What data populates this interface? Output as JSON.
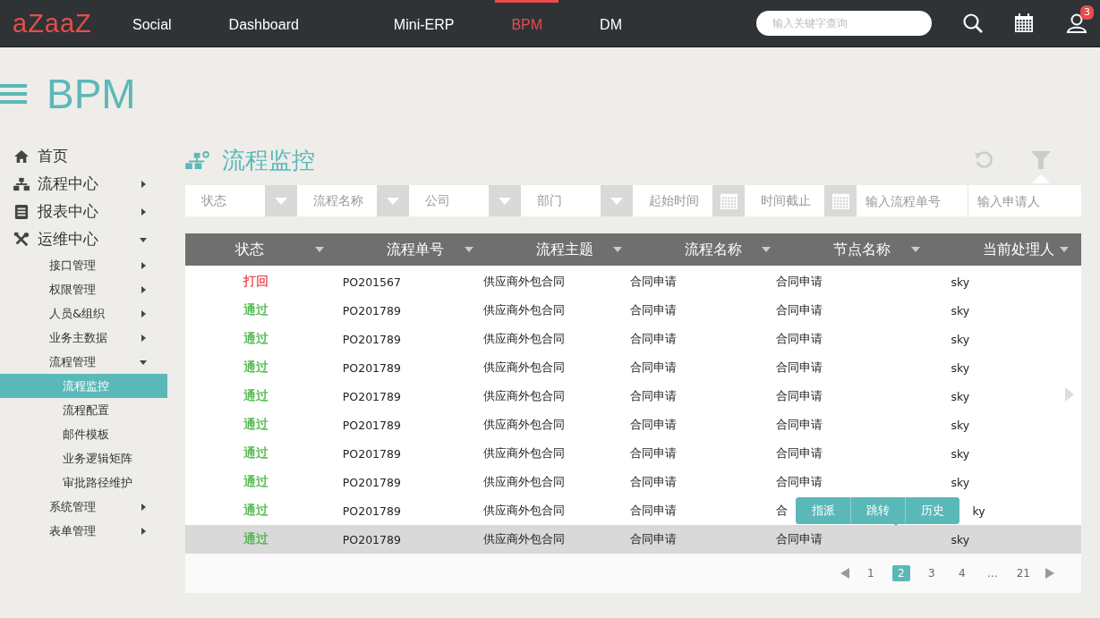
{
  "topbar": {
    "logo": "aZaaZ",
    "nav": [
      {
        "label": "Social",
        "selected": false
      },
      {
        "label": "Dashboard",
        "selected": false
      },
      {
        "label": "Mini-ERP",
        "selected": false
      },
      {
        "label": "BPM",
        "selected": true
      },
      {
        "label": "DM",
        "selected": false
      }
    ],
    "search": {
      "placeholder": "输入关键字查询"
    },
    "notification_count": "3"
  },
  "app_title": "BPM",
  "sidebar": {
    "items": [
      {
        "label": "首页",
        "selected": false
      },
      {
        "label": "流程中心",
        "selected": false,
        "expanded": false
      },
      {
        "label": "报表中心",
        "selected": false,
        "expanded": false
      },
      {
        "label": "运维中心",
        "selected": false,
        "expanded": true,
        "children": [
          {
            "label": "接口管理",
            "selected": false,
            "expanded": false
          },
          {
            "label": "权限管理",
            "selected": false,
            "expanded": false
          },
          {
            "label": "人员&组织",
            "selected": false,
            "expanded": false
          },
          {
            "label": "业务主数据",
            "selected": false,
            "expanded": false
          },
          {
            "label": "流程管理",
            "selected": false,
            "expanded": true,
            "children": [
              {
                "label": "流程监控",
                "selected": true
              },
              {
                "label": "流程配置",
                "selected": false
              },
              {
                "label": "邮件模板",
                "selected": false
              },
              {
                "label": "业务逻辑矩阵",
                "selected": false
              },
              {
                "label": "审批路径维护",
                "selected": false
              }
            ]
          },
          {
            "label": "系统管理",
            "selected": false,
            "expanded": false
          },
          {
            "label": "表单管理",
            "selected": false,
            "expanded": false
          }
        ]
      }
    ]
  },
  "page_title": "流程监控",
  "filters": [
    {
      "kind": "select",
      "placeholder": "状态"
    },
    {
      "kind": "select",
      "placeholder": "流程名称"
    },
    {
      "kind": "select",
      "placeholder": "公司"
    },
    {
      "kind": "select",
      "placeholder": "部门"
    },
    {
      "kind": "date",
      "placeholder": "起始时间"
    },
    {
      "kind": "date",
      "placeholder": "时间截止"
    },
    {
      "kind": "text",
      "placeholder": "输入流程单号"
    },
    {
      "kind": "text",
      "placeholder": "输入申请人"
    }
  ],
  "table": {
    "columns": [
      "状态",
      "流程单号",
      "流程主题",
      "流程名称",
      "节点名称",
      "当前处理人"
    ],
    "rows": [
      {
        "status": "打回",
        "color": "#e85050",
        "number": "PO201567",
        "subject": "供应商外包合同",
        "process": "合同申请",
        "node": "合同申请",
        "handler": "sky",
        "selected": false
      },
      {
        "status": "通过",
        "color": "#4cb848",
        "number": "PO201789",
        "subject": "供应商外包合同",
        "process": "合同申请",
        "node": "合同申请",
        "handler": "sky",
        "selected": false
      },
      {
        "status": "通过",
        "color": "#4cb848",
        "number": "PO201789",
        "subject": "供应商外包合同",
        "process": "合同申请",
        "node": "合同申请",
        "handler": "sky",
        "selected": false
      },
      {
        "status": "通过",
        "color": "#4cb848",
        "number": "PO201789",
        "subject": "供应商外包合同",
        "process": "合同申请",
        "node": "合同申请",
        "handler": "sky",
        "selected": false
      },
      {
        "status": "通过",
        "color": "#4cb848",
        "number": "PO201789",
        "subject": "供应商外包合同",
        "process": "合同申请",
        "node": "合同申请",
        "handler": "sky",
        "selected": false
      },
      {
        "status": "通过",
        "color": "#4cb848",
        "number": "PO201789",
        "subject": "供应商外包合同",
        "process": "合同申请",
        "node": "合同申请",
        "handler": "sky",
        "selected": false
      },
      {
        "status": "通过",
        "color": "#4cb848",
        "number": "PO201789",
        "subject": "供应商外包合同",
        "process": "合同申请",
        "node": "合同申请",
        "handler": "sky",
        "selected": false
      },
      {
        "status": "通过",
        "color": "#4cb848",
        "number": "PO201789",
        "subject": "供应商外包合同",
        "process": "合同申请",
        "node": "合同申请",
        "handler": "sky",
        "selected": false
      },
      {
        "status": "通过",
        "color": "#4cb848",
        "number": "PO201789",
        "subject": "供应商外包合同",
        "process": "合同申请",
        "node": "合",
        "handler": "ky",
        "selected": false
      },
      {
        "status": "通过",
        "color": "#4cb848",
        "number": "PO201789",
        "subject": "供应商外包合同",
        "process": "合同申请",
        "node": "合同申请",
        "handler": "sky",
        "selected": true
      }
    ]
  },
  "row_actions": [
    "指派",
    "跳转",
    "历史"
  ],
  "pagination": {
    "pages": [
      {
        "label": "1",
        "selected": false
      },
      {
        "label": "2",
        "selected": true
      },
      {
        "label": "3",
        "selected": false
      },
      {
        "label": "4",
        "selected": false
      },
      {
        "label": "…",
        "selected": false
      },
      {
        "label": "21",
        "selected": false
      }
    ]
  }
}
